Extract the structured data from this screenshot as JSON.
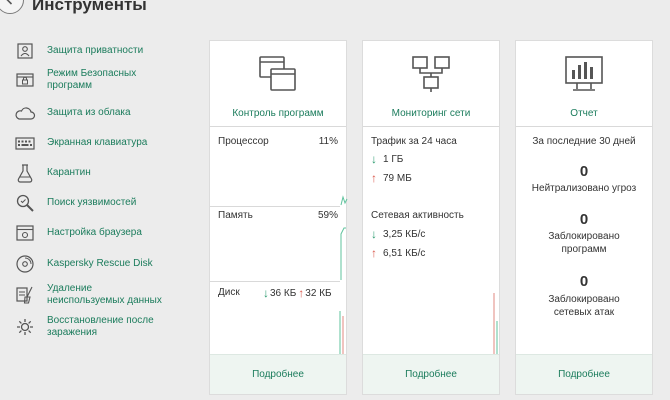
{
  "header": {
    "title": "Инструменты"
  },
  "sidebar": {
    "items": [
      {
        "label": "Защита приватности",
        "icon": "privacy-icon"
      },
      {
        "label": "Режим Безопасных программ",
        "icon": "safe-apps-icon"
      },
      {
        "label": "Защита из облака",
        "icon": "cloud-icon"
      },
      {
        "label": "Экранная клавиатура",
        "icon": "keyboard-icon"
      },
      {
        "label": "Карантин",
        "icon": "quarantine-icon"
      },
      {
        "label": "Поиск уязвимостей",
        "icon": "vulnerability-search-icon"
      },
      {
        "label": "Настройка браузера",
        "icon": "browser-settings-icon"
      },
      {
        "label": "Kaspersky Rescue Disk",
        "icon": "rescue-disk-icon"
      },
      {
        "label": "Удаление неиспользуемых данных",
        "icon": "cleanup-icon"
      },
      {
        "label": "Восстановление после заражения",
        "icon": "recovery-icon"
      }
    ]
  },
  "cards": {
    "apps": {
      "title": "Контроль программ",
      "cpu_label": "Процессор",
      "cpu_value": "11%",
      "mem_label": "Память",
      "mem_value": "59%",
      "disk_label": "Диск",
      "disk_down": "36 КБ",
      "disk_up": "32 КБ",
      "more": "Подробнее"
    },
    "net": {
      "title": "Мониторинг сети",
      "traffic_label": "Трафик за 24 часа",
      "traffic_down": "1 ГБ",
      "traffic_up": "79 МБ",
      "activity_label": "Сетевая активность",
      "activity_down": "3,25 КБ/с",
      "activity_up": "6,51 КБ/с",
      "more": "Подробнее"
    },
    "report": {
      "title": "Отчет",
      "period": "За последние 30 дней",
      "stat1_value": "0",
      "stat1_label": "Нейтрализовано угроз",
      "stat2_value": "0",
      "stat2_label": "Заблокировано программ",
      "stat3_value": "0",
      "stat3_label": "Заблокировано сетевых атак",
      "more": "Подробнее"
    }
  },
  "colors": {
    "accent": "#1b7c5c",
    "down_arrow": "#2a9a6e",
    "up_arrow": "#d9584c"
  }
}
